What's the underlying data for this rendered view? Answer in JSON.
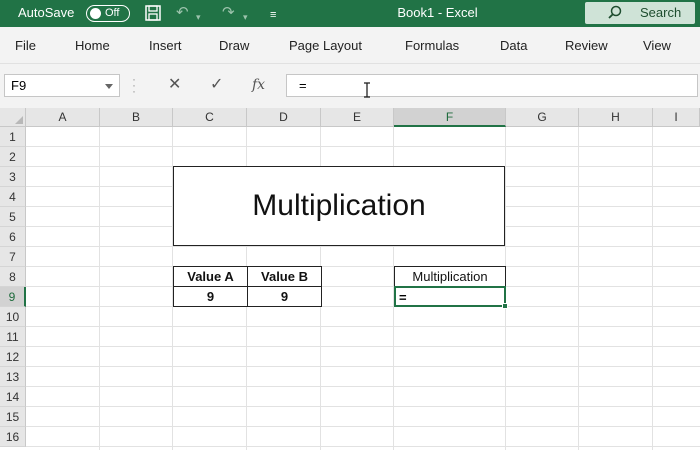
{
  "titlebar": {
    "autosave_label": "AutoSave",
    "autosave_state": "Off",
    "book_title": "Book1  -  Excel",
    "search_label": "Search",
    "accent_color": "#217346"
  },
  "ribbon": {
    "tabs": [
      "File",
      "Home",
      "Insert",
      "Draw",
      "Page Layout",
      "Formulas",
      "Data",
      "Review",
      "View"
    ]
  },
  "formula_bar": {
    "name_box": "F9",
    "formula": "=",
    "icons": [
      "cancel-icon",
      "enter-icon",
      "insert-function-icon"
    ]
  },
  "grid": {
    "columns": [
      "A",
      "B",
      "C",
      "D",
      "E",
      "F",
      "G",
      "H",
      "I"
    ],
    "rows": [
      "1",
      "2",
      "3",
      "4",
      "5",
      "6",
      "7",
      "8",
      "9",
      "10",
      "11",
      "12",
      "13",
      "14",
      "15",
      "16"
    ],
    "active_column": "F",
    "active_row": "9"
  },
  "sheet": {
    "title": "Multiplication",
    "header_a": "Value A",
    "header_b": "Value B",
    "value_a": "9",
    "value_b": "9",
    "result_header": "Multiplication",
    "active_cell_value": "="
  }
}
